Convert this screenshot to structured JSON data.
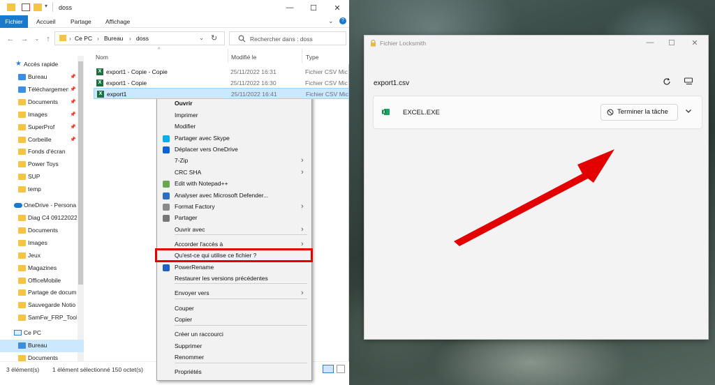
{
  "explorer": {
    "title": "doss",
    "ribbon_tabs": [
      "Fichier",
      "Accueil",
      "Partage",
      "Affichage"
    ],
    "breadcrumb": [
      "Ce PC",
      "Bureau",
      "doss"
    ],
    "search_placeholder": "Rechercher dans : doss",
    "nav": {
      "quick_access": "Accès rapide",
      "quick_items": [
        "Bureau",
        "Téléchargemen",
        "Documents",
        "Images",
        "SuperProf",
        "Corbeille",
        "Fonds d'écran",
        "Power Toys",
        "SUP",
        "temp"
      ],
      "onedrive": "OneDrive - Persona",
      "onedrive_items": [
        "Diag C4 09122022",
        "Documents",
        "Images",
        "Jeux",
        "Magazines",
        "OfficeMobile",
        "Partage de docum",
        "Sauvegarde Notio",
        "SamFw_FRP_Tool_"
      ],
      "this_pc": "Ce PC",
      "pc_items": [
        "Bureau",
        "Documents"
      ]
    },
    "columns": {
      "name": "Nom",
      "modified": "Modifié le",
      "type": "Type"
    },
    "files": [
      {
        "name": "export1 - Copie - Copie",
        "date": "25/11/2022 16:31",
        "type": "Fichier CSV Mic"
      },
      {
        "name": "export1 - Copie",
        "date": "25/11/2022 16:30",
        "type": "Fichier CSV Mic"
      },
      {
        "name": "export1",
        "date": "25/11/2022 16:41",
        "type": "Fichier CSV Mic"
      }
    ],
    "status": {
      "count": "3 élément(s)",
      "selection": "1 élément sélectionné  150 octet(s)"
    }
  },
  "context_menu": {
    "items": [
      "Ouvrir",
      "Imprimer",
      "Modifier",
      "Partager avec Skype",
      "Déplacer vers OneDrive",
      "7-Zip",
      "CRC SHA",
      "Edit with Notepad++",
      "Analyser avec Microsoft Defender...",
      "Format Factory",
      "Partager",
      "Ouvrir avec",
      "Accorder l'accès à",
      "Qu'est-ce qui utilise ce fichier ?",
      "PowerRename",
      "Restaurer les versions précédentes",
      "Envoyer vers",
      "Couper",
      "Copier",
      "Créer un raccourci",
      "Supprimer",
      "Renommer",
      "Propriétés"
    ]
  },
  "locksmith": {
    "title": "Fichier Locksmith",
    "file": "export1.csv",
    "process": "EXCEL.EXE",
    "end_task": "Terminer la tâche"
  },
  "colors": {
    "highlight": "#e30000",
    "arrow": "#e30000",
    "accent": "#1979ca",
    "selection": "#cce8ff"
  }
}
